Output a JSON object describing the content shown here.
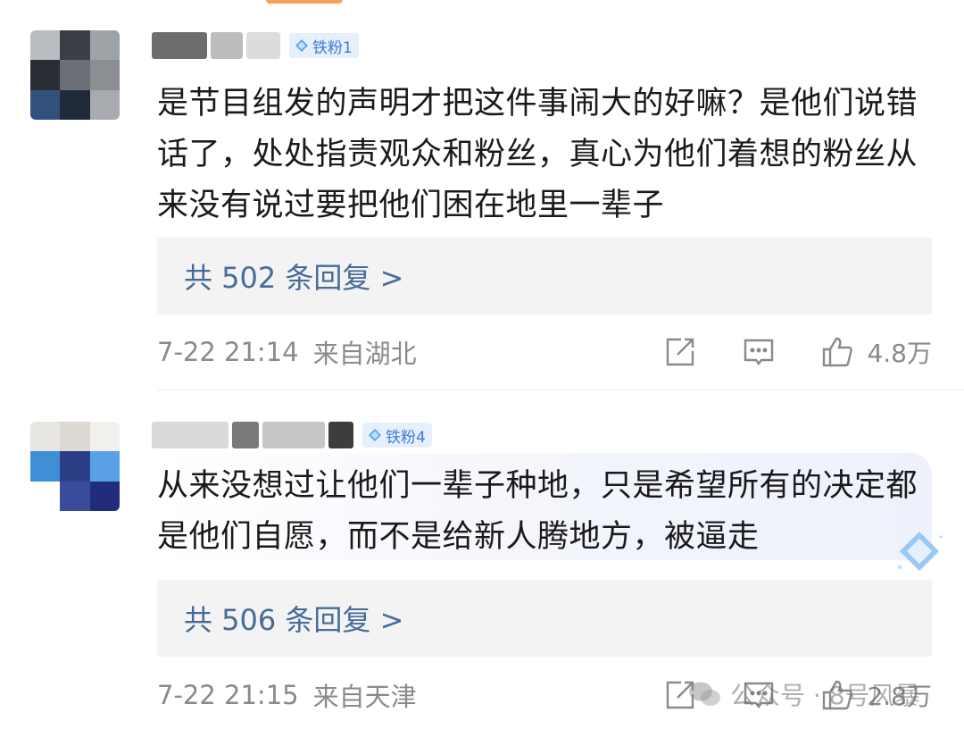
{
  "comments": [
    {
      "badge": "铁粉1",
      "text": "是节目组发的声明才把这件事闹大的好嘛？是他们说错话了，处处指责观众和粉丝，真心为他们着想的粉丝从来没有说过要把他们困在地里一辈子",
      "replies": "共 502 条回复 >",
      "time": "7-22 21:14",
      "location": "来自湖北",
      "likes": "4.8万"
    },
    {
      "badge": "铁粉4",
      "text": "从来没想过让他们一辈子种地，只是希望所有的决定都是他们自愿，而不是给新人腾地方，被逼走",
      "replies": "共 506 条回复 >",
      "time": "7-22 21:15",
      "location": "来自天津",
      "likes": "2.8万"
    }
  ],
  "watermark": "公众号 · 8号风暴",
  "colors": {
    "link": "#466b9a",
    "badge_bg": "#e6f0fb",
    "badge_text": "#3c7bd6",
    "reply_bg": "#f3f3f3",
    "meta": "#8a8a8a"
  },
  "icons": [
    "diamond-badge-icon",
    "share-icon",
    "comment-icon",
    "like-icon",
    "wechat-icon"
  ]
}
